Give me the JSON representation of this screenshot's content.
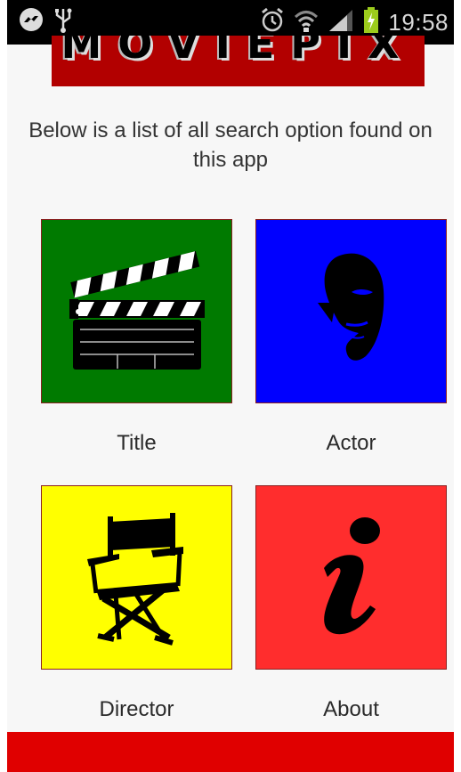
{
  "status_bar": {
    "time": "19:58",
    "icons": [
      "messenger-icon",
      "usb-icon",
      "alarm-icon",
      "wifi-icon",
      "signal-icon",
      "battery-charging-icon"
    ]
  },
  "banner": {
    "title": "MOVIEPIX",
    "color": "#b20000"
  },
  "intro_text": "Below is a list of all search option found on this app",
  "tiles": [
    {
      "label": "Title",
      "color": "#007a00",
      "icon": "clapperboard-icon"
    },
    {
      "label": "Actor",
      "color": "#0000ff",
      "icon": "mask-face-icon"
    },
    {
      "label": "Director",
      "color": "#ffff00",
      "icon": "director-chair-icon"
    },
    {
      "label": "About",
      "color": "#ff2d2d",
      "icon": "info-icon"
    }
  ],
  "bottom_bar_color": "#e00000"
}
